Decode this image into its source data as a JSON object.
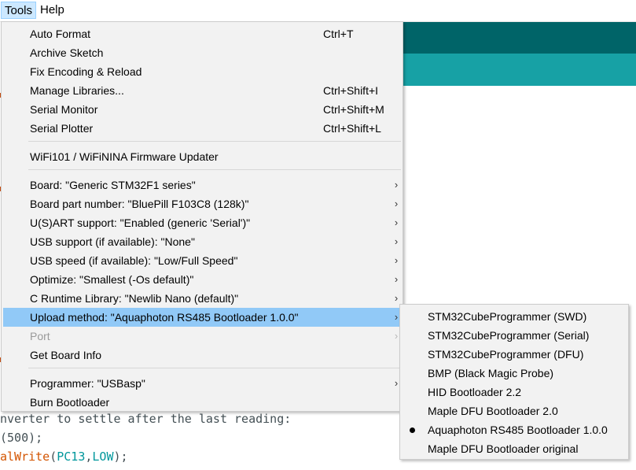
{
  "menubar": {
    "tools": "Tools",
    "help": "Help"
  },
  "tools_menu": {
    "items": [
      {
        "label": "Auto Format",
        "shortcut": "Ctrl+T"
      },
      {
        "label": "Archive Sketch",
        "shortcut": ""
      },
      {
        "label": "Fix Encoding & Reload",
        "shortcut": ""
      },
      {
        "label": "Manage Libraries...",
        "shortcut": "Ctrl+Shift+I"
      },
      {
        "label": "Serial Monitor",
        "shortcut": "Ctrl+Shift+M"
      },
      {
        "label": "Serial Plotter",
        "shortcut": "Ctrl+Shift+L"
      },
      {
        "label": "WiFi101 / WiFiNINA Firmware Updater",
        "shortcut": ""
      },
      {
        "label": "Board: \"Generic STM32F1 series\"",
        "shortcut": ""
      },
      {
        "label": "Board part number: \"BluePill F103C8 (128k)\"",
        "shortcut": ""
      },
      {
        "label": "U(S)ART support: \"Enabled (generic 'Serial')\"",
        "shortcut": ""
      },
      {
        "label": "USB support (if available): \"None\"",
        "shortcut": ""
      },
      {
        "label": "USB speed (if available): \"Low/Full Speed\"",
        "shortcut": ""
      },
      {
        "label": "Optimize: \"Smallest (-Os default)\"",
        "shortcut": ""
      },
      {
        "label": "C Runtime Library: \"Newlib Nano (default)\"",
        "shortcut": ""
      },
      {
        "label": "Upload method: \"Aquaphoton RS485 Bootloader 1.0.0\"",
        "shortcut": ""
      },
      {
        "label": "Port",
        "shortcut": ""
      },
      {
        "label": "Get Board Info",
        "shortcut": ""
      },
      {
        "label": "Programmer: \"USBasp\"",
        "shortcut": ""
      },
      {
        "label": "Burn Bootloader",
        "shortcut": ""
      }
    ],
    "submenu_arrow": "›"
  },
  "upload_submenu": {
    "items": [
      {
        "label": "STM32CubeProgrammer (SWD)"
      },
      {
        "label": "STM32CubeProgrammer (Serial)"
      },
      {
        "label": "STM32CubeProgrammer (DFU)"
      },
      {
        "label": "BMP (Black Magic Probe)"
      },
      {
        "label": "HID Bootloader 2.2"
      },
      {
        "label": "Maple DFU Bootloader 2.0"
      },
      {
        "label": "Aquaphoton RS485 Bootloader 1.0.0"
      },
      {
        "label": "Maple DFU Bootloader original"
      }
    ]
  },
  "editor": {
    "line1": "nverter to settle after the last reading:",
    "line2_a": "(500);",
    "line3_fn": "alWrite",
    "line3_p1": "(",
    "line3_arg1": "PC13",
    "line3_comma": ",",
    "line3_arg2": "LOW",
    "line3_end": ");"
  },
  "colors": {
    "highlight": "#91c9f7",
    "menu_bg": "#f2f2f2",
    "teal_dark": "#006468",
    "teal_light": "#17a1a5"
  }
}
